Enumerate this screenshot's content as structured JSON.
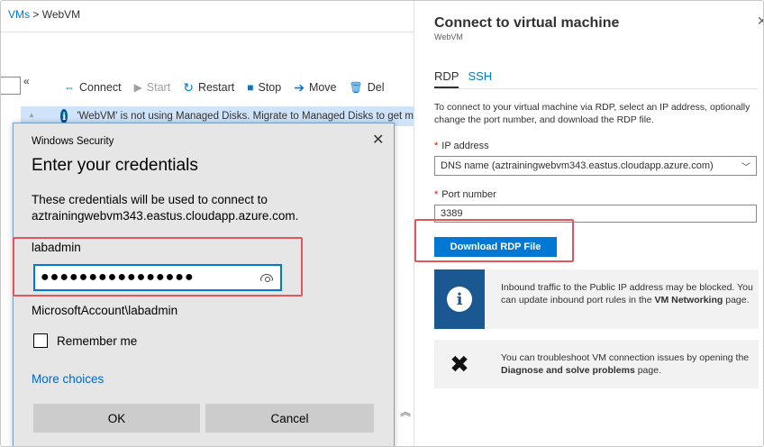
{
  "breadcrumb": {
    "parent": "VMs",
    "separator": ">",
    "current": "WebVM"
  },
  "portal": {
    "collapse_label": "«",
    "toolbar": {
      "connect": "Connect",
      "start": "Start",
      "restart": "Restart",
      "stop": "Stop",
      "move": "Move",
      "delete": "Del"
    },
    "banner_text": "'WebVM' is not using Managed Disks. Migrate to Managed Disks to get m"
  },
  "windows_security": {
    "title": "Windows Security",
    "close": "✕",
    "heading": "Enter your credentials",
    "description": "These credentials will be used to connect to aztrainingwebvm343.eastus.cloudapp.azure.com.",
    "username": "labadmin",
    "password_mask": "●●●●●●●●●●●●●●●●",
    "account": "MicrosoftAccount\\labadmin",
    "remember_label": "Remember me",
    "remember_checked": false,
    "more_choices": "More choices",
    "ok_label": "OK",
    "cancel_label": "Cancel"
  },
  "connect_panel": {
    "title": "Connect to virtual machine",
    "subtitle": "WebVM",
    "close": "✕",
    "tabs": [
      {
        "label": "RDP",
        "active": true
      },
      {
        "label": "SSH",
        "active": false
      }
    ],
    "description": "To connect to your virtual machine via RDP, select an IP address, optionally change the port number, and download the RDP file.",
    "ip_label": "IP address",
    "ip_value": "DNS name (aztrainingwebvm343.eastus.cloudapp.azure.com)",
    "port_label": "Port number",
    "port_value": "3389",
    "download_label": "Download RDP File",
    "info_text_1": "Inbound traffic to the Public IP address may be blocked. You can update inbound port rules in the ",
    "info_link": "VM Networking",
    "info_text_2": " page.",
    "tool_text_1": "You can troubleshoot VM connection issues by opening the ",
    "tool_link": "Diagnose and solve problems",
    "tool_text_2": " page."
  },
  "colors": {
    "accent": "#0078d4",
    "highlight": "#e0565b",
    "dialog_bg": "#e6e6e6",
    "info_block": "#1a5891"
  }
}
